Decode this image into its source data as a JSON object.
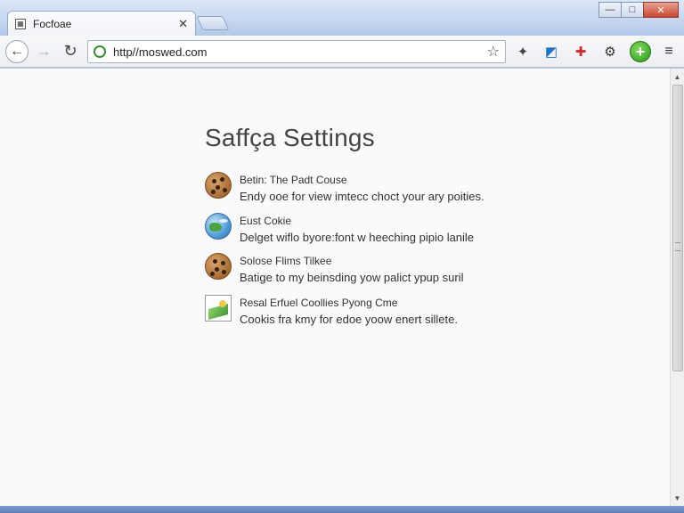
{
  "window": {
    "tab_title": "Focfoae",
    "tab_close": "✕",
    "minimize": "—",
    "maximize": "□",
    "close": "✕"
  },
  "toolbar": {
    "back": "←",
    "forward": "→",
    "reload": "↻",
    "url": "http//moswed.com",
    "bookmark_star": "☆",
    "extensions": [
      "✦",
      "◩",
      "✚",
      "⚙",
      "+"
    ],
    "menu": "≡"
  },
  "page": {
    "title": "Saffça Settings",
    "items": [
      {
        "heading": "Betin: The Padt Couse",
        "description": "Endy ooe for view imtecc choct your ary poities.",
        "icon": "cookie-icon"
      },
      {
        "heading": "Eust Cokie",
        "description": "Delget wiflo byore:font w heeching pipio lanile",
        "icon": "globe-icon"
      },
      {
        "heading": "Solose Flims Tilkee",
        "description": "Batige to my beinsding yow palict ypup suril",
        "icon": "cookie-icon"
      },
      {
        "heading": "Resal Erfuel Coollies Pyong Cme",
        "description": "Cookis fra kmy for edoe yoow enert sillete.",
        "icon": "image-icon"
      }
    ]
  },
  "colors": {
    "chrome_frame": "#b3c9ea",
    "page_background": "#fafafa",
    "accent_green": "#2b9b1b",
    "close_red": "#c9462f"
  }
}
